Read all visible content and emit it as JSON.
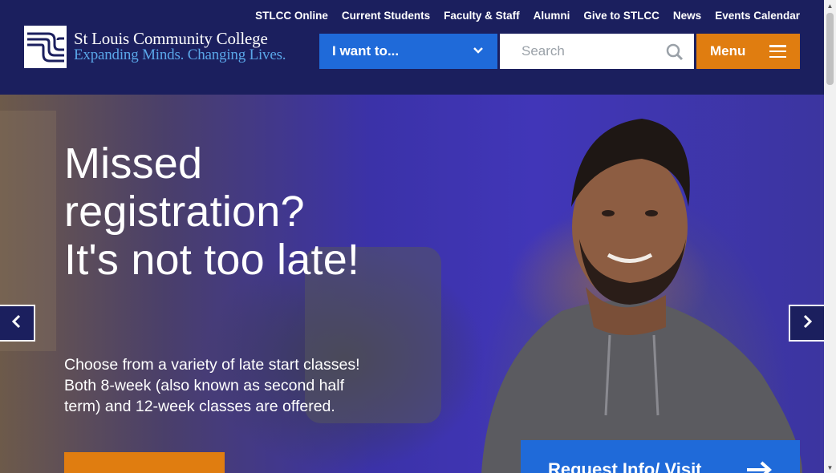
{
  "header": {
    "logo_name": "St Louis Community College",
    "logo_tagline": "Expanding Minds. Changing Lives.",
    "top_links": [
      "STLCC Online",
      "Current Students",
      "Faculty & Staff",
      "Alumni",
      "Give to STLCC",
      "News",
      "Events Calendar"
    ],
    "i_want_label": "I want to...",
    "search_placeholder": "Search",
    "menu_label": "Menu"
  },
  "hero": {
    "title": "Missed registration? It's not too late!",
    "text": "Choose from a variety of late start classes! Both 8-week (also known as second half term) and 12-week classes are offered.",
    "request_label": "Request Info/ Visit"
  },
  "colors": {
    "navy": "#1b1f5e",
    "blue": "#1f6ad9",
    "orange": "#e07d10",
    "tagline_blue": "#5aa6e8"
  },
  "icons": {
    "search": "search-icon",
    "menu": "hamburger-icon",
    "dropdown": "chevron-down-icon",
    "prev": "chevron-left-icon",
    "next": "chevron-right-icon",
    "request": "arrow-right-icon"
  }
}
